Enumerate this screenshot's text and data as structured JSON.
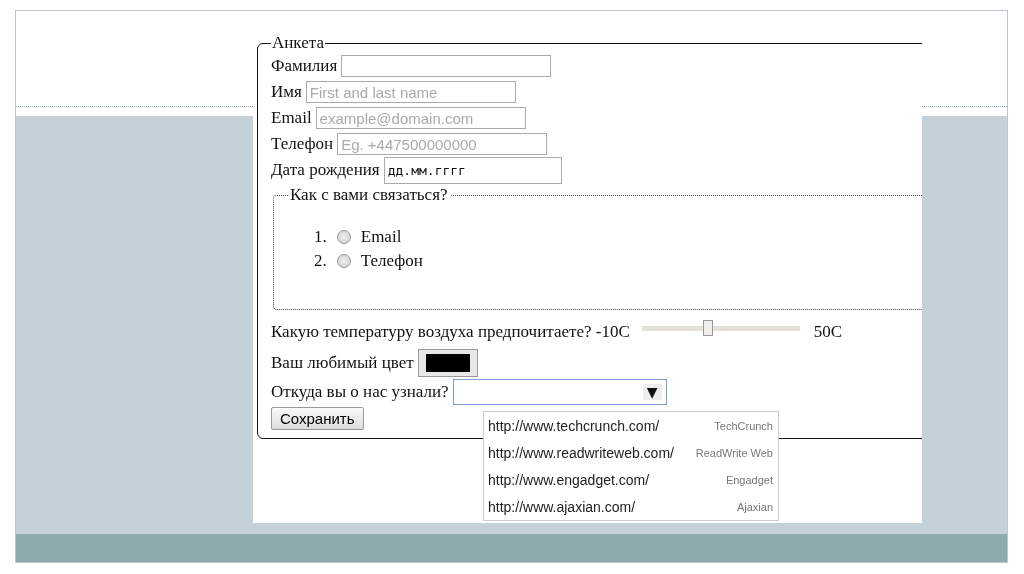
{
  "form": {
    "legend": "Анкета",
    "fields": [
      {
        "kind": "text",
        "label": "Фамилия"
      },
      {
        "kind": "text",
        "label": "Имя",
        "placeholder": "First and last name"
      },
      {
        "kind": "text",
        "label": "Email",
        "placeholder": "example@domain.com"
      },
      {
        "kind": "text",
        "label": "Телефон",
        "placeholder": "Eg. +447500000000"
      },
      {
        "kind": "date",
        "label": "Дата рождения",
        "value": "дд.мм.гггг"
      }
    ],
    "contact": {
      "legend": "Как с вами связаться?",
      "options": [
        {
          "number": "1.",
          "label": "Email",
          "checked": false
        },
        {
          "number": "2.",
          "label": "Телефон",
          "checked": false
        }
      ]
    },
    "temperature": {
      "label": "Какую температуру воздуха предпочитаете? -10C",
      "level": 0.42,
      "max_label": "50C"
    },
    "favorite_color": {
      "label": "Ваш любимый цвет",
      "color": "#000000"
    },
    "source": {
      "label": "Откуда вы о нас узнали?",
      "arrow": "▼",
      "options": [
        {
          "url": "http://www.techcrunch.com/",
          "title": "TechCrunch",
          "selected": false
        },
        {
          "url": "http://www.readwriteweb.com/",
          "title": "ReadWrite Web",
          "selected": false
        },
        {
          "url": "http://www.engadget.com/",
          "title": "Engadget",
          "selected": false
        },
        {
          "url": "http://www.ajaxian.com/",
          "title": "Ajaxian",
          "selected": false
        }
      ]
    },
    "submit": "Сохранить"
  }
}
